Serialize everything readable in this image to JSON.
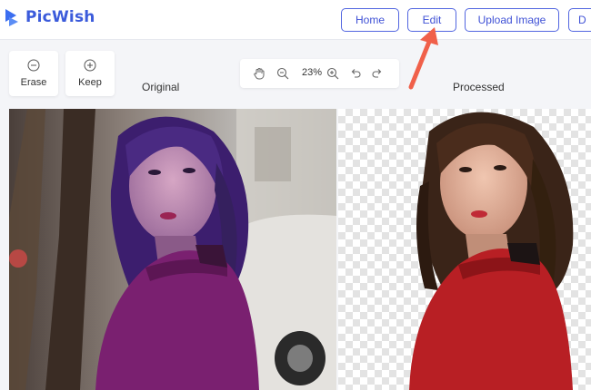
{
  "brand": {
    "name": "PicWish"
  },
  "nav": {
    "home": "Home",
    "edit": "Edit",
    "upload": "Upload Image",
    "cut_off": "D"
  },
  "tools": {
    "erase": {
      "label": "Erase",
      "icon": "minus-circle-icon"
    },
    "keep": {
      "label": "Keep",
      "icon": "plus-circle-icon"
    }
  },
  "zoom": {
    "value": "23%",
    "icons": [
      "hand-icon",
      "zoom-out-icon",
      "zoom-in-icon",
      "undo-icon",
      "redo-icon"
    ]
  },
  "panels": {
    "original_label": "Original",
    "processed_label": "Processed"
  },
  "colors": {
    "brand": "#3b5bdb",
    "nav_border": "#5266e0",
    "annotation_arrow": "#f0604a"
  }
}
